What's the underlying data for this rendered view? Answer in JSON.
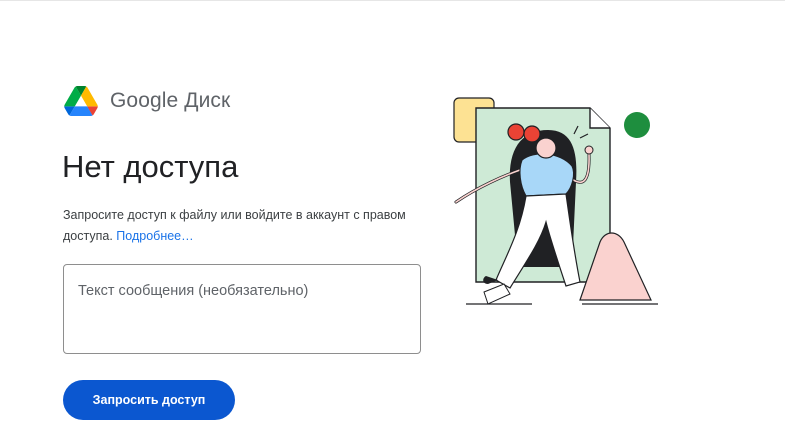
{
  "brand": {
    "logo_icon": "google-drive-logo-icon",
    "product_name": "Google Диск"
  },
  "main": {
    "title": "Нет доступа",
    "description": "Запросите доступ к файлу или войдите в аккаунт с правом доступа.",
    "learn_more_link": "Подробнее…"
  },
  "message": {
    "placeholder": "Текст сообщения (необязательно)",
    "value": ""
  },
  "actions": {
    "request_button_label": "Запросить доступ"
  },
  "illustration": {
    "icon": "person-running-through-document-illustration"
  },
  "colors": {
    "primary_button": "#0b57d0",
    "link": "#1a73e8",
    "illustration_green": "#ceead6",
    "illustration_dot": "#1e8e3e",
    "illustration_yellow": "#fde293",
    "illustration_pink": "#fad2cf",
    "illustration_red": "#ea4335"
  }
}
